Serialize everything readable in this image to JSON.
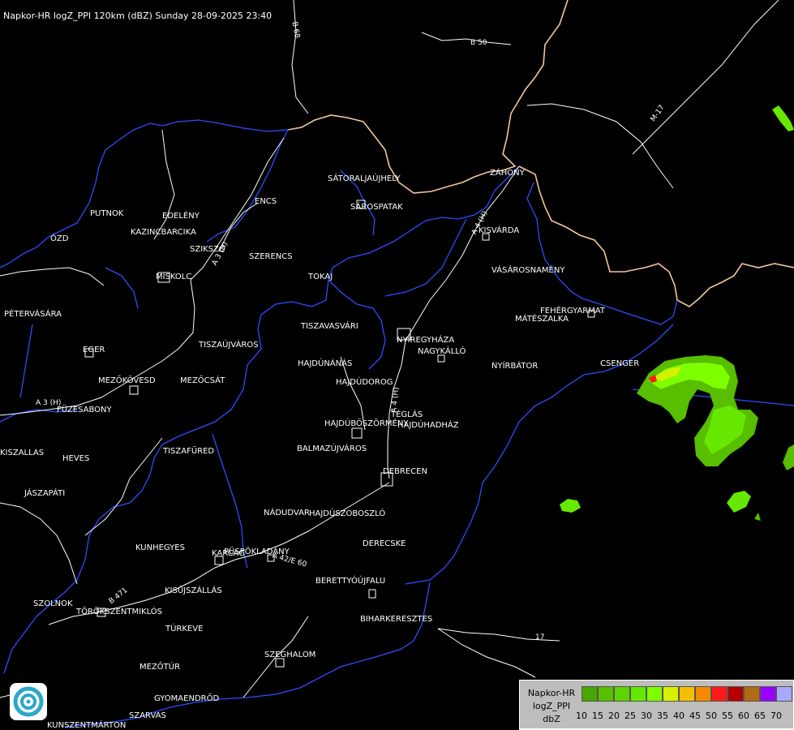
{
  "header": {
    "title": "Napkor-HR logZ_PPI 120km (dBZ) Sunday 28-09-2025 23:40"
  },
  "cities": [
    {
      "name": "SÁTORALJAÚJHELY"
    },
    {
      "name": "SÁROSPATAK"
    },
    {
      "name": "ZÁHONY"
    },
    {
      "name": "KISVÁRDA"
    },
    {
      "name": "VÁSÁROSNAMÉNY"
    },
    {
      "name": "FEHÉRGYARMAT"
    },
    {
      "name": "MÁTÉSZALKA"
    },
    {
      "name": "CSENGER"
    },
    {
      "name": "NYÍRBÁTOR"
    },
    {
      "name": "NAGYKÁLLÓ"
    },
    {
      "name": "NYÍREGYHÁZA"
    },
    {
      "name": "TISZAVASVÁRI"
    },
    {
      "name": "TOKAJ"
    },
    {
      "name": "SZERENCS"
    },
    {
      "name": "ENCS"
    },
    {
      "name": "PUTNOK"
    },
    {
      "name": "EDELÉNY"
    },
    {
      "name": "KAZINCBARCIKA"
    },
    {
      "name": "SZIKSZÓ"
    },
    {
      "name": "ÓZD"
    },
    {
      "name": "MISKOLC"
    },
    {
      "name": "PÉTERVÁSÁRA"
    },
    {
      "name": "EGER"
    },
    {
      "name": "TISZAÚJVÁROS"
    },
    {
      "name": "MEZŐKÖVESD"
    },
    {
      "name": "MEZŐCSÁT"
    },
    {
      "name": "FÜZESABONY"
    },
    {
      "name": "HAJDÚNÁNÁS"
    },
    {
      "name": "HAJDÚDOROG"
    },
    {
      "name": "HAJDÚBÖSZÖRMÉNY"
    },
    {
      "name": "TÉGLÁS"
    },
    {
      "name": "HAJDÚHADHÁZ"
    },
    {
      "name": "BALMAZÚJVÁROS"
    },
    {
      "name": "DEBRECEN"
    },
    {
      "name": "KISZALLAS"
    },
    {
      "name": "HEVES"
    },
    {
      "name": "TISZAFÜRED"
    },
    {
      "name": "JÁSZAPÁTI"
    },
    {
      "name": "NÁDUDVAR"
    },
    {
      "name": "HAJDÚSZOBOSZLÓ"
    },
    {
      "name": "DERECSKE"
    },
    {
      "name": "KUNHEGYES"
    },
    {
      "name": "KARCAG"
    },
    {
      "name": "PÜSPÖKLADÁNY"
    },
    {
      "name": "BERETTYÓÚJFALU"
    },
    {
      "name": "KISÚJSZÁLLÁS"
    },
    {
      "name": "SZOLNOK"
    },
    {
      "name": "TÖRÖKSZENTMIKLÓS"
    },
    {
      "name": "BIHARKERESZTES"
    },
    {
      "name": "TÚRKEVE"
    },
    {
      "name": "SZEGHALOM"
    },
    {
      "name": "MEZŐTÚR"
    },
    {
      "name": "GYOMAENDRŐD"
    },
    {
      "name": "SZARVAS"
    },
    {
      "name": "KUNSZENTMÁRTON"
    }
  ],
  "roads": [
    {
      "label": "B 68"
    },
    {
      "label": "B 50"
    },
    {
      "label": "M-17"
    },
    {
      "label": "A 3 (H)"
    },
    {
      "label": "A 3 (H)"
    },
    {
      "label": "A 4 (H)"
    },
    {
      "label": "A 4 (H)"
    },
    {
      "label": "A 42/E 60"
    },
    {
      "label": "B 471"
    },
    {
      "label": "17"
    }
  ],
  "legend": {
    "line1": "Napkor-HR",
    "line2": "logZ_PPI",
    "line3": "dbZ",
    "levels": [
      {
        "value": "10",
        "color": "#4aa600"
      },
      {
        "value": "15",
        "color": "#57be00"
      },
      {
        "value": "20",
        "color": "#5ed400"
      },
      {
        "value": "25",
        "color": "#66e800"
      },
      {
        "value": "30",
        "color": "#7dff00"
      },
      {
        "value": "35",
        "color": "#d7f000"
      },
      {
        "value": "40",
        "color": "#f2c000"
      },
      {
        "value": "45",
        "color": "#f58a00"
      },
      {
        "value": "50",
        "color": "#ff1a1a"
      },
      {
        "value": "55",
        "color": "#b40000"
      },
      {
        "value": "60",
        "color": "#b06c14"
      },
      {
        "value": "65",
        "color": "#9a00ff"
      },
      {
        "value": "70",
        "color": "#a8a8ff"
      }
    ]
  },
  "colors": {
    "background": "#000000",
    "river": "#2e4cff",
    "road": "#ffffff",
    "border": "#f2c79a",
    "logo": "#2aa8c8"
  }
}
